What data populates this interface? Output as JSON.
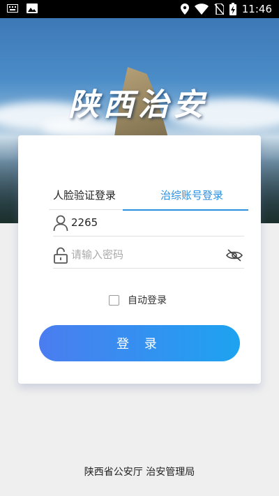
{
  "statusbar": {
    "time": "11:46",
    "icons_left": [
      "keyboard-icon",
      "image-icon"
    ],
    "icons_right": [
      "location-icon",
      "wifi-icon",
      "no-sim-icon",
      "battery-charging-icon"
    ]
  },
  "hero": {
    "title": "陕西治安"
  },
  "login": {
    "tabs": [
      {
        "label": "人脸验证登录",
        "active": false
      },
      {
        "label": "治综账号登录",
        "active": true
      }
    ],
    "username": {
      "value": "2265",
      "icon": "user-icon"
    },
    "password": {
      "value": "",
      "placeholder": "请输入密码",
      "icon": "lock-icon",
      "toggle_icon": "eye-hidden-icon"
    },
    "remember": {
      "label": "自动登录",
      "checked": false
    },
    "submit_label": "登 录"
  },
  "footer": {
    "text": "陕西省公安厅 治安管理局"
  },
  "colors": {
    "accent": "#2a8fe0",
    "button_start": "#4b7df0",
    "button_end": "#1ea3f0",
    "background": "#efefef"
  }
}
